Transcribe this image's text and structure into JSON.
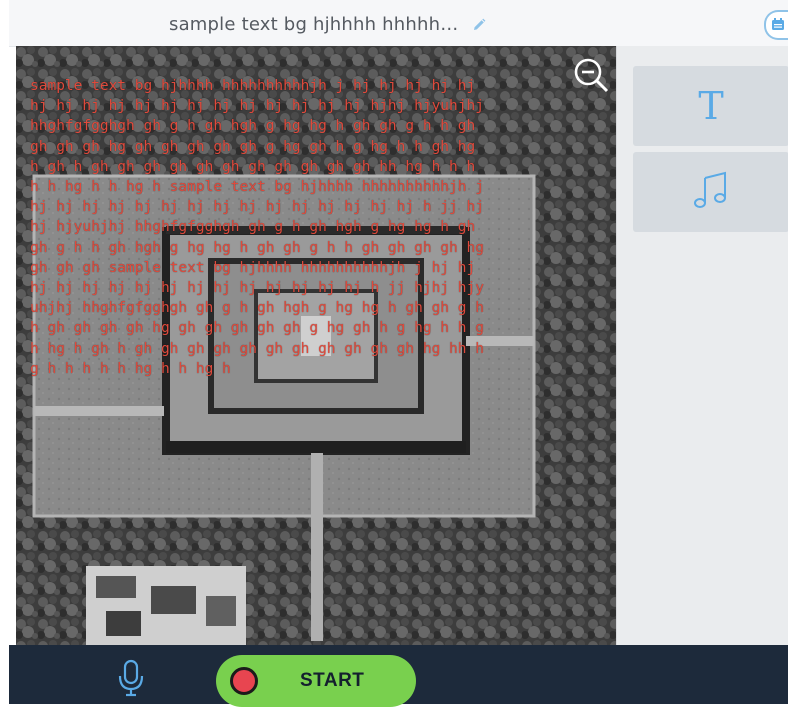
{
  "header": {
    "title": "sample text bg hjhhhh hhhhh…",
    "edit_icon": "pencil-icon",
    "right_icon": "calendar-icon"
  },
  "canvas": {
    "background": "satellite-map-image",
    "overlay_text": "sample text bg hjhhhh hhhhhhhhhhjh j hj hj hj hj hj hj hj hj hj hj hj hj hj hj hj hj hj hj hjhj hjyuhjhj hhghfgfgghgh gh g h gh hgh g hg hg h gh gh g h h gh gh gh gh hg gh gh gh gh gh g hg gh h g hg h h gh hg h gh h gh gh gh gh gh gh gh gh gh gh gh hh hg h h h h h hg h h hg h sample text bg hjhhhh hhhhhhhhhhjh j hj hj hj hj hj hj hj hj hj hj hj hj hj hj hj h jj hjhj hjyuhjhj hhghfgfgghgh gh g h gh hgh g hg hg h gh gh g h h gh hgh g hg hg h gh gh g h h gh gh gh gh hg gh gh gh sample text bg hjhhhh hhhhhhhhhhjh j hj hj hj hj hj hj hj hj hj hj hj hj hj hj hj h jj hjhj hjyuhjhj hhghfgfgghgh gh g h gh hgh g hg hg h gh gh g h h gh gh gh gh hg gh gh gh gh gh g hg gh h g hg h h gh hg h gh h gh gh gh gh gh gh gh gh gh gh gh hg hh hg h h h h h hg h h hg h",
    "zoom_icon": "zoom-out-icon"
  },
  "tools": [
    {
      "name": "text-tool",
      "glyph": "T",
      "icon": "text-icon"
    },
    {
      "name": "music-tool",
      "icon": "music-note-icon"
    }
  ],
  "bottom_bar": {
    "mic_icon": "microphone-icon",
    "start_label": "START",
    "record_icon": "record-dot-icon"
  },
  "colors": {
    "accent_blue": "#5aaae6",
    "start_green": "#79d04e",
    "record_red": "#e84550",
    "overlay_red": "#e04a3c",
    "bottom_bar": "#1d2a3b"
  }
}
